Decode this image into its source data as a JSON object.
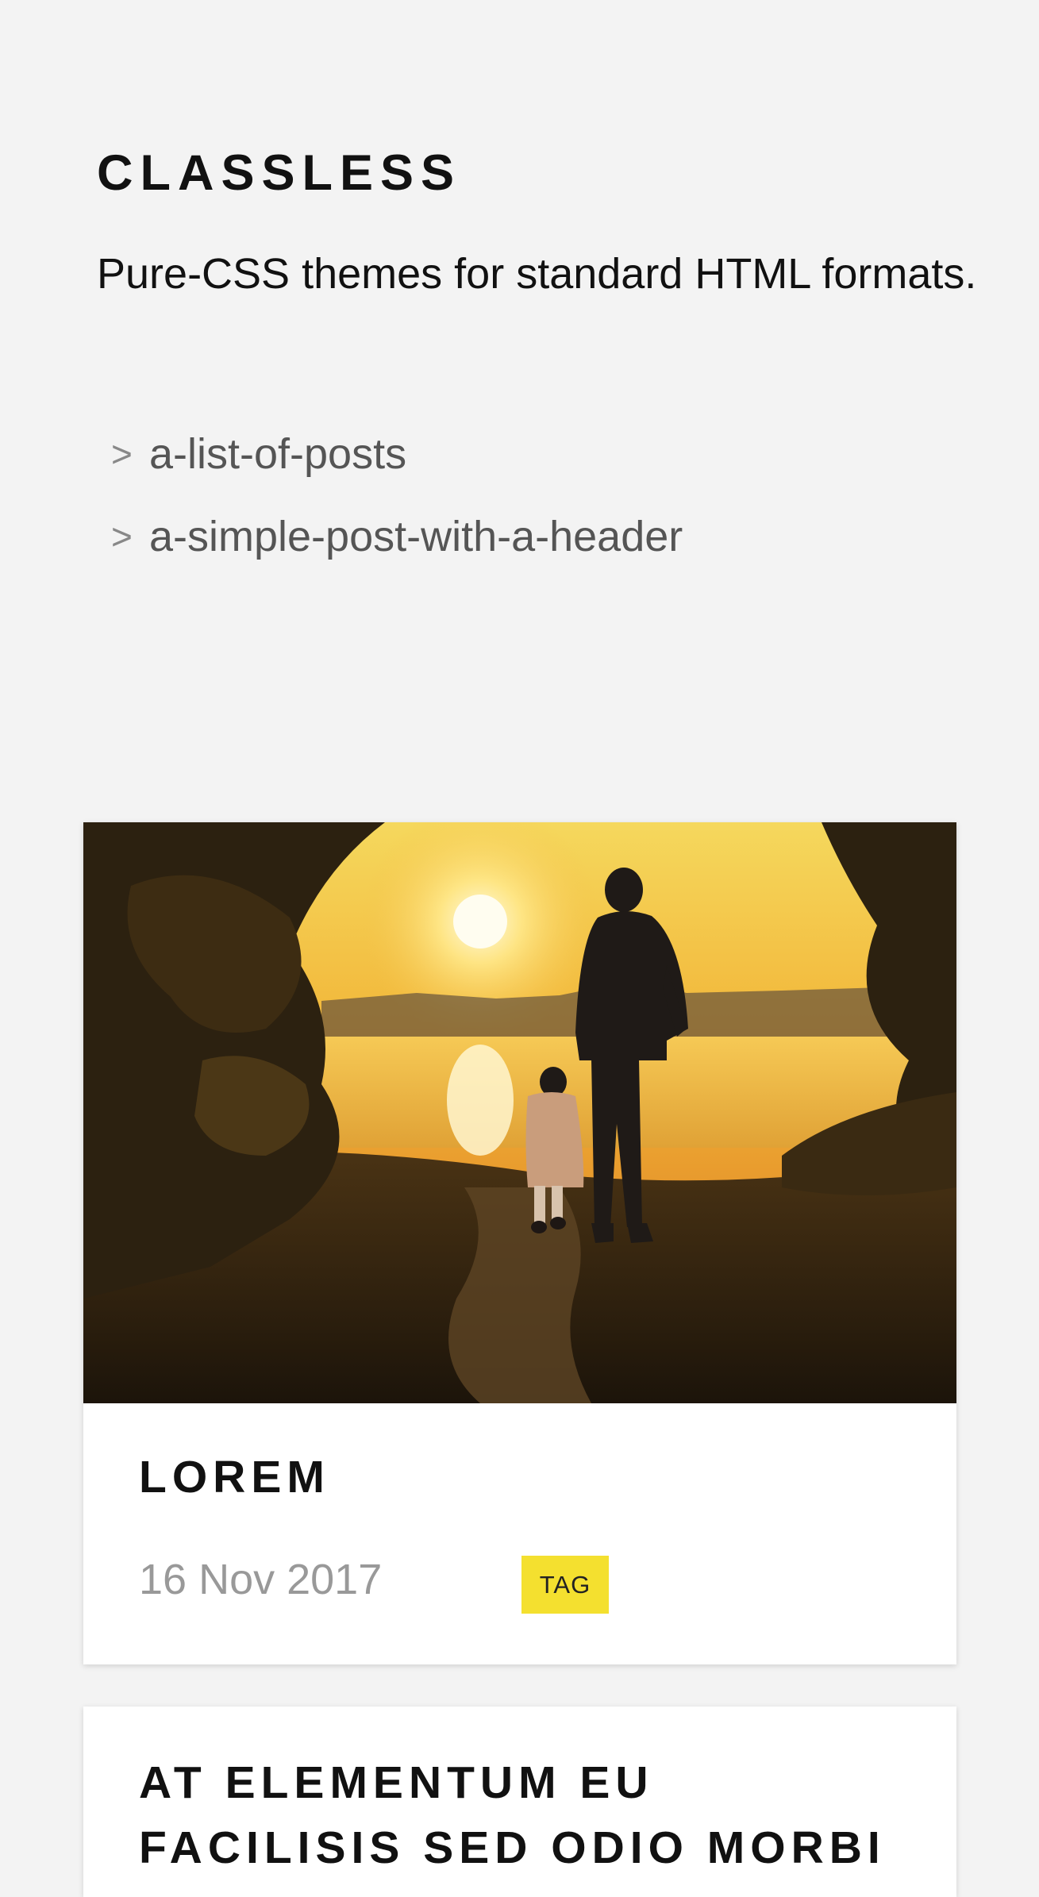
{
  "site": {
    "title": "CLASSLESS",
    "tagline": "Pure-CSS themes for standard HTML formats."
  },
  "nav": {
    "items": [
      {
        "marker": ">",
        "label": "a-list-of-posts"
      },
      {
        "marker": ">",
        "label": "a-simple-post-with-a-header"
      }
    ]
  },
  "posts": [
    {
      "title": "LOREM",
      "date": "16 Nov 2017",
      "tag": "TAG",
      "image_icon": "sunset-photo-icon"
    },
    {
      "title_line1": "AT ELEMENTUM EU",
      "title_line2": "FACILISIS SED ODIO MORBI"
    }
  ],
  "colors": {
    "background": "#f3f3f3",
    "card": "#ffffff",
    "tag": "#f4e02f",
    "muted_text": "#999999"
  }
}
